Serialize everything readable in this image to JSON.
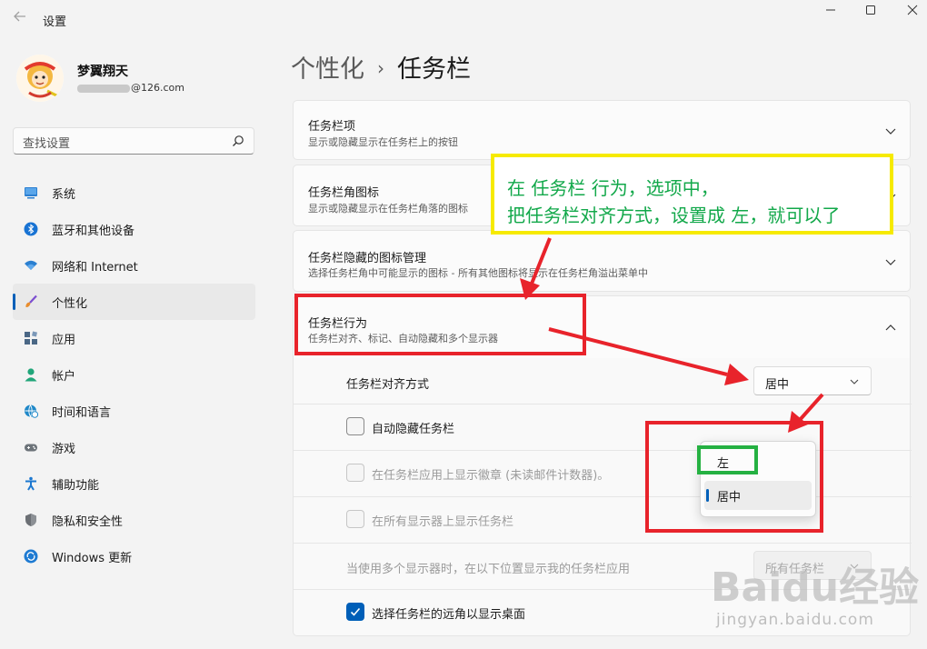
{
  "window": {
    "title": "设置",
    "back_icon": "arrow-left-icon",
    "controls": [
      "minimize-icon",
      "maximize-icon",
      "close-icon"
    ]
  },
  "profile": {
    "name": "梦翼翔天",
    "email_suffix": "@126.com"
  },
  "search": {
    "placeholder": "查找设置",
    "icon": "search-icon"
  },
  "nav": {
    "items": [
      {
        "label": "系统",
        "icon": "system-icon",
        "color": "#2b7fd1"
      },
      {
        "label": "蓝牙和其他设备",
        "icon": "bluetooth-icon",
        "color": "#1873d3"
      },
      {
        "label": "网络和 Internet",
        "icon": "wifi-icon",
        "color": "#2a7fd0"
      },
      {
        "label": "个性化",
        "icon": "brush-icon",
        "color": "#e88d2d",
        "selected": true
      },
      {
        "label": "应用",
        "icon": "apps-icon",
        "color": "#4a6785"
      },
      {
        "label": "帐户",
        "icon": "account-icon",
        "color": "#21a67a"
      },
      {
        "label": "时间和语言",
        "icon": "globe-clock-icon",
        "color": "#1f88c8"
      },
      {
        "label": "游戏",
        "icon": "gamepad-icon",
        "color": "#6c7379"
      },
      {
        "label": "辅助功能",
        "icon": "accessibility-icon",
        "color": "#1c78d0"
      },
      {
        "label": "隐私和安全性",
        "icon": "shield-icon",
        "color": "#6b6f74"
      },
      {
        "label": "Windows 更新",
        "icon": "update-icon",
        "color": "#1d7ad2"
      }
    ]
  },
  "breadcrumb": {
    "parent": "个性化",
    "separator": "›",
    "current": "任务栏"
  },
  "sections": [
    {
      "title": "任务栏项",
      "desc": "显示或隐藏显示在任务栏上的按钮",
      "expanded": false
    },
    {
      "title": "任务栏角图标",
      "desc": "显示或隐藏显示在任务栏角落的图标",
      "expanded": false
    },
    {
      "title": "任务栏隐藏的图标管理",
      "desc": "选择任务栏角中可能显示的图标 - 所有其他图标将显示在任务栏角溢出菜单中",
      "expanded": false
    },
    {
      "title": "任务栏行为",
      "desc": "任务栏对齐、标记、自动隐藏和多个显示器",
      "expanded": true
    }
  ],
  "behavior": {
    "alignment": {
      "label": "任务栏对齐方式",
      "value": "居中"
    },
    "auto_hide": {
      "label": "自动隐藏任务栏",
      "checked": false
    },
    "badges": {
      "label": "在任务栏应用上显示徽章 (未读邮件计数器)。",
      "checked": false,
      "disabled": true
    },
    "all_displays": {
      "label": "在所有显示器上显示任务栏",
      "checked": false,
      "disabled": true
    },
    "multi_display": {
      "label": "当使用多个显示器时，在以下位置显示我的任务栏应用",
      "value": "所有任务栏",
      "disabled": true
    },
    "far_corner": {
      "label": "选择任务栏的远角以显示桌面",
      "checked": true
    }
  },
  "alignment_options": [
    {
      "label": "左",
      "selected": false
    },
    {
      "label": "居中",
      "selected": true
    }
  ],
  "annotation": {
    "line1": "在 任务栏 行为，选项中，",
    "line2": "把任务栏对齐方式，设置成 左，就可以了"
  },
  "colors": {
    "accent": "#005fb8",
    "annot_red": "#e8232b",
    "annot_yellow": "#f6ea00",
    "annot_green": "#25b142",
    "annot_text": "#12a84a"
  },
  "watermark": {
    "logo": "Baidu经验",
    "url": "jingyan.baidu.com"
  }
}
